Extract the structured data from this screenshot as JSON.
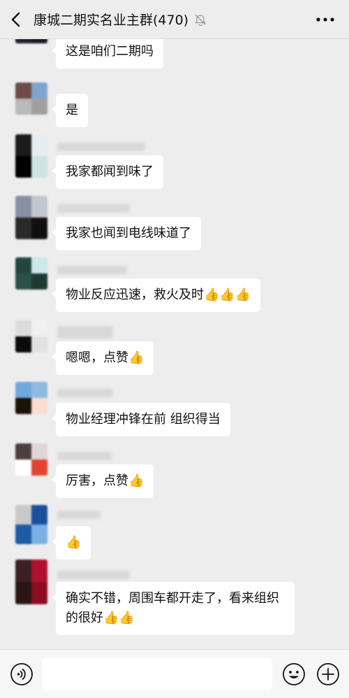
{
  "header": {
    "title": "康城二期实名业主群(470)",
    "back_icon": "chevron-left-icon",
    "mute_icon": "bell-mute-icon",
    "more_icon": "more-dots-icon"
  },
  "messages": [
    {
      "text": "这是咱们二期吗",
      "thumbs": ""
    },
    {
      "text": "是",
      "thumbs": ""
    },
    {
      "text": "我家都闻到味了",
      "thumbs": ""
    },
    {
      "text": "我家也闻到电线味道了",
      "thumbs": ""
    },
    {
      "text": "物业反应迅速，救火及时",
      "thumbs": "👍👍👍"
    },
    {
      "text": "嗯嗯，点赞",
      "thumbs": "👍"
    },
    {
      "text": "物业经理冲锋在前 组织得当",
      "thumbs": ""
    },
    {
      "text": "厉害，点赞",
      "thumbs": "👍"
    },
    {
      "text": "",
      "thumbs": "👍"
    },
    {
      "text": "确实不错，周围车都开走了，看来组织的很好",
      "thumbs": "👍👍"
    }
  ],
  "bottom_bar": {
    "voice_icon": "voice-icon",
    "emoji_icon": "emoji-icon",
    "plus_icon": "plus-icon"
  },
  "colors": {
    "background": "#ededed",
    "bubble": "#ffffff"
  }
}
